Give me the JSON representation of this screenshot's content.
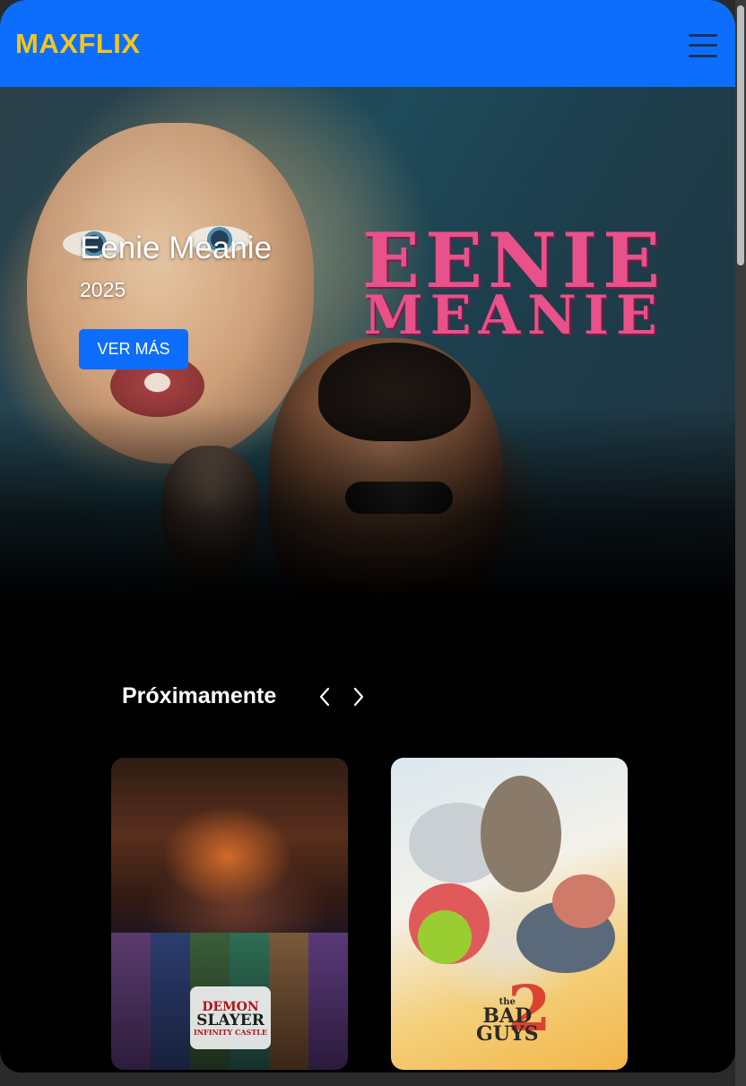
{
  "header": {
    "brand": "MAXFLIX",
    "menu_icon": "hamburger-menu-icon"
  },
  "hero": {
    "title": "Eenie Meanie",
    "year": "2025",
    "button_label": "VER MÁS",
    "poster_title_line1": "EENIE",
    "poster_title_line2": "MEANIE"
  },
  "upcoming": {
    "title": "Próximamente",
    "prev_icon": "chevron-left-icon",
    "next_icon": "chevron-right-icon",
    "cards": [
      {
        "logo_top": "DEMON",
        "logo_mid": "SLAYER",
        "logo_bottom": "INFINITY CASTLE"
      },
      {
        "logo_top": "the",
        "logo_mid": "BAD",
        "logo_bottom": "GUYS",
        "number": "2"
      }
    ]
  },
  "colors": {
    "accent": "#0d6efd",
    "brand": "#f5c518",
    "background": "#000000",
    "poster_pink": "#e8518a"
  }
}
